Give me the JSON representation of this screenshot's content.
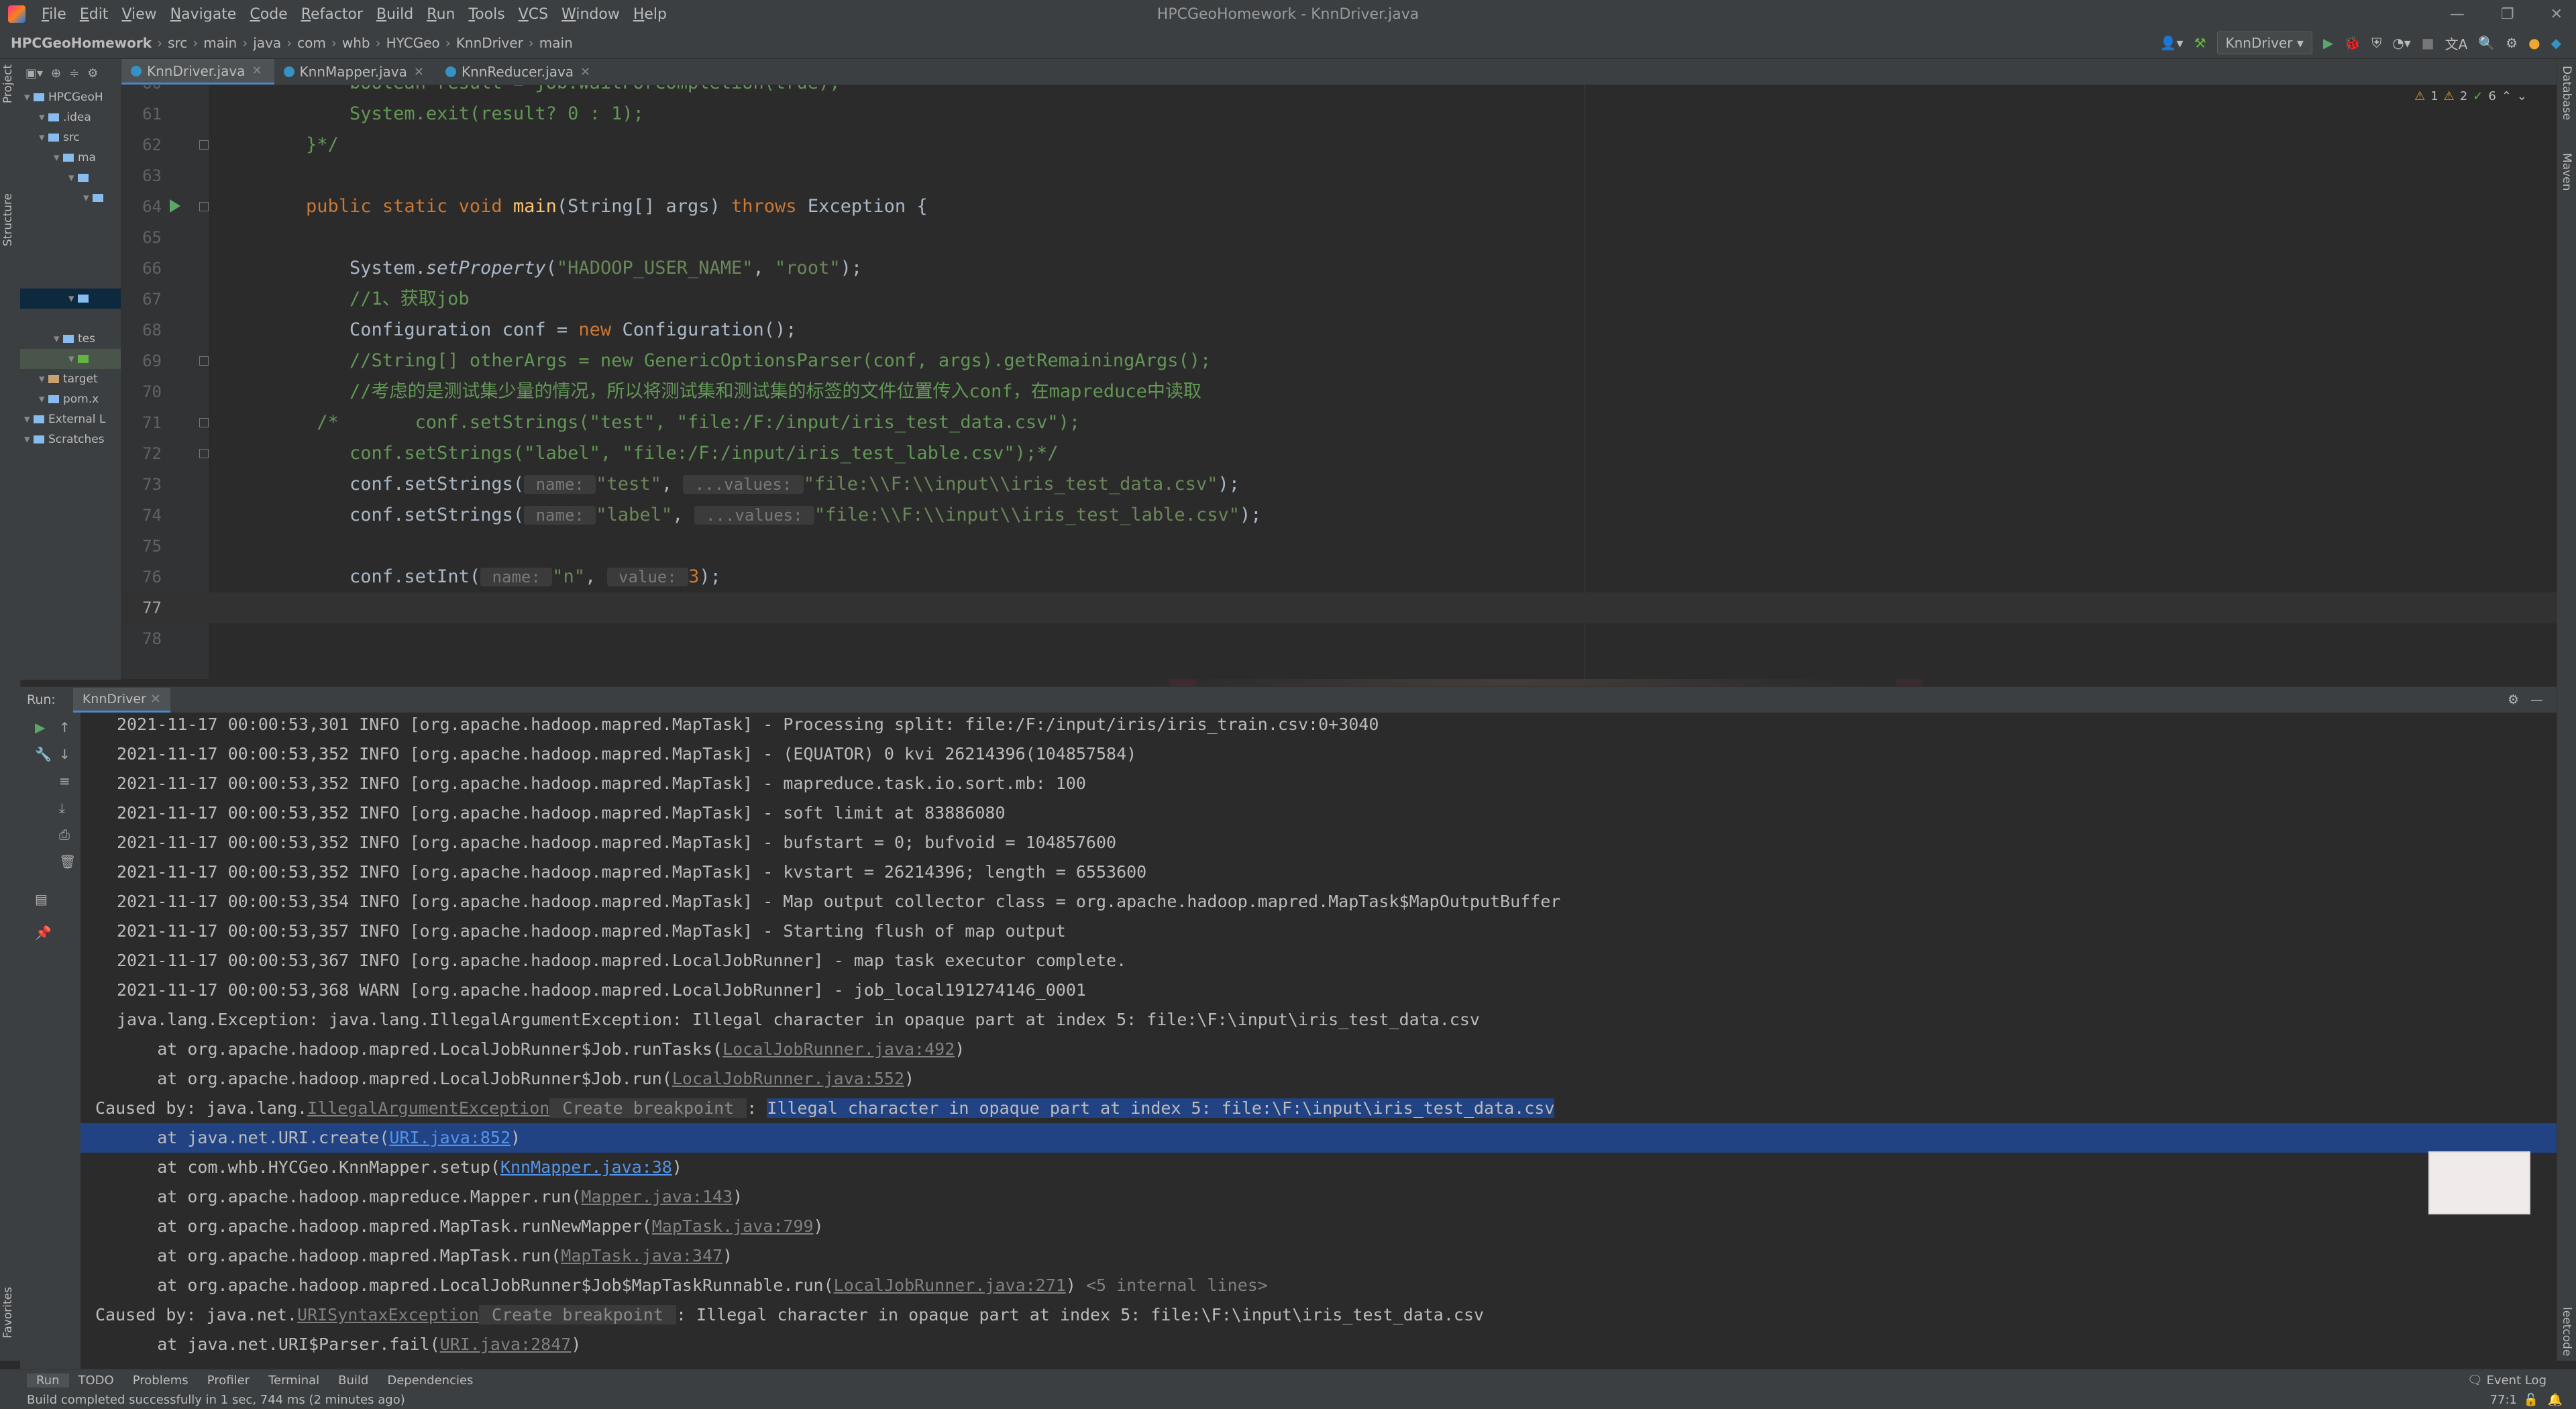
{
  "window": {
    "title": "HPCGeoHomework - KnnDriver.java",
    "menu": [
      {
        "mnemonic": "F",
        "rest": "ile"
      },
      {
        "mnemonic": "E",
        "rest": "dit"
      },
      {
        "mnemonic": "V",
        "rest": "iew"
      },
      {
        "mnemonic": "N",
        "rest": "avigate"
      },
      {
        "mnemonic": "C",
        "rest": "ode"
      },
      {
        "mnemonic": "R",
        "rest": "efactor"
      },
      {
        "mnemonic": "B",
        "rest": "uild"
      },
      {
        "mnemonic": "R",
        "rest": "un"
      },
      {
        "mnemonic": "T",
        "rest": "ools"
      },
      {
        "mnemonic": "V",
        "rest": "CS"
      },
      {
        "mnemonic": "W",
        "rest": "indow"
      },
      {
        "mnemonic": "H",
        "rest": "elp"
      }
    ]
  },
  "breadcrumb": [
    "HPCGeoHomework",
    "src",
    "main",
    "java",
    "com",
    "whb",
    "HYCGeo",
    "KnnDriver",
    "main"
  ],
  "run_config": "KnnDriver",
  "left_tabs": [
    "Project",
    "Structure",
    "Favorites"
  ],
  "right_tabs": [
    "Database",
    "Maven",
    "leetcode"
  ],
  "project_tree": [
    {
      "label": "HPCGeoH",
      "indent": 0,
      "state": ""
    },
    {
      "label": ".idea",
      "indent": 1,
      "state": ""
    },
    {
      "label": "src",
      "indent": 1,
      "state": ""
    },
    {
      "label": "ma",
      "indent": 2,
      "state": ""
    },
    {
      "label": "",
      "indent": 3,
      "state": ""
    },
    {
      "label": "",
      "indent": 4,
      "state": ""
    },
    {
      "label": "",
      "indent": 0,
      "state": "blank"
    },
    {
      "label": "",
      "indent": 0,
      "state": "blank"
    },
    {
      "label": "",
      "indent": 0,
      "state": "blank"
    },
    {
      "label": "",
      "indent": 0,
      "state": "blank"
    },
    {
      "label": "",
      "indent": 3,
      "state": "sel"
    },
    {
      "label": "",
      "indent": 0,
      "state": "blank"
    },
    {
      "label": "tes",
      "indent": 2,
      "state": ""
    },
    {
      "label": "",
      "indent": 3,
      "state": "hl"
    },
    {
      "label": "target",
      "indent": 1,
      "state": ""
    },
    {
      "label": "pom.x",
      "indent": 1,
      "state": ""
    },
    {
      "label": "External L",
      "indent": 0,
      "state": ""
    },
    {
      "label": "Scratches",
      "indent": 0,
      "state": ""
    }
  ],
  "tabs": [
    {
      "label": "KnnDriver.java",
      "active": true
    },
    {
      "label": "KnnMapper.java",
      "active": false
    },
    {
      "label": "KnnReducer.java",
      "active": false
    }
  ],
  "inspections": {
    "warnings": "1",
    "weak": "2",
    "typos": "6"
  },
  "editor": {
    "current_line": "77",
    "lines": [
      {
        "n": "60",
        "segs": [
          {
            "t": "        boolean result = job.waitForCompletion(",
            "c": "cm-cn"
          },
          {
            "t": "true",
            "c": "cm-cn"
          },
          {
            "t": ");",
            "c": "cm-cn"
          }
        ]
      },
      {
        "n": "61",
        "segs": [
          {
            "t": "        System.exit(result? 0 : 1);",
            "c": "cm-cn"
          }
        ]
      },
      {
        "n": "62",
        "segs": [
          {
            "t": "    }*/",
            "c": "cm-cn"
          }
        ]
      },
      {
        "n": "63",
        "segs": []
      },
      {
        "n": "64",
        "segs": [
          {
            "t": "    ",
            "c": ""
          },
          {
            "t": "public static void ",
            "c": "kw"
          },
          {
            "t": "main",
            "c": "fn"
          },
          {
            "t": "(String[] args) ",
            "c": ""
          },
          {
            "t": "throws ",
            "c": "kw"
          },
          {
            "t": "Exception {",
            "c": ""
          }
        ]
      },
      {
        "n": "65",
        "segs": []
      },
      {
        "n": "66",
        "segs": [
          {
            "t": "        System.",
            "c": ""
          },
          {
            "t": "setProperty",
            "c": "it"
          },
          {
            "t": "(",
            "c": ""
          },
          {
            "t": "\"HADOOP_USER_NAME\"",
            "c": "str"
          },
          {
            "t": ", ",
            "c": ""
          },
          {
            "t": "\"root\"",
            "c": "str"
          },
          {
            "t": ");",
            "c": ""
          }
        ]
      },
      {
        "n": "67",
        "segs": [
          {
            "t": "        //1、获取job",
            "c": "cm-cn"
          }
        ]
      },
      {
        "n": "68",
        "segs": [
          {
            "t": "        Configuration conf = ",
            "c": ""
          },
          {
            "t": "new ",
            "c": "kw"
          },
          {
            "t": "Configuration();",
            "c": ""
          }
        ]
      },
      {
        "n": "69",
        "segs": [
          {
            "t": "        //String[] otherArgs = new GenericOptionsParser(conf, args).getRemainingArgs();",
            "c": "cm-cn"
          }
        ]
      },
      {
        "n": "70",
        "segs": [
          {
            "t": "        //考虑的是测试集少量的情况，所以将测试集和测试集的标签的文件位置传入conf，在mapreduce中读取",
            "c": "cm-cn"
          }
        ]
      },
      {
        "n": "71",
        "segs": [
          {
            "t": "     /*",
            "c": "cm-cn"
          },
          {
            "t": "       conf.setStrings(\"test\", \"file:/F:/input/iris_test_data.csv\");",
            "c": "cm-cn"
          }
        ]
      },
      {
        "n": "72",
        "segs": [
          {
            "t": "        conf.setStrings(\"label\", \"file:/F:/input/iris_test_lable.csv\");*/",
            "c": "cm-cn"
          }
        ]
      },
      {
        "n": "73",
        "segs": [
          {
            "t": "        conf.setStrings(",
            "c": ""
          },
          {
            "t": " name: ",
            "c": "hint"
          },
          {
            "t": "\"test\"",
            "c": "str"
          },
          {
            "t": ", ",
            "c": ""
          },
          {
            "t": " ...values: ",
            "c": "hint"
          },
          {
            "t": "\"file:\\\\F:\\\\input\\\\iris_test_data.csv\"",
            "c": "str"
          },
          {
            "t": ");",
            "c": ""
          }
        ]
      },
      {
        "n": "74",
        "segs": [
          {
            "t": "        conf.setStrings(",
            "c": ""
          },
          {
            "t": " name: ",
            "c": "hint"
          },
          {
            "t": "\"label\"",
            "c": "str"
          },
          {
            "t": ", ",
            "c": ""
          },
          {
            "t": " ...values: ",
            "c": "hint"
          },
          {
            "t": "\"file:\\\\F:\\\\input\\\\iris_test_lable.csv\"",
            "c": "str"
          },
          {
            "t": ");",
            "c": ""
          }
        ]
      },
      {
        "n": "75",
        "segs": []
      },
      {
        "n": "76",
        "segs": [
          {
            "t": "        conf.setInt(",
            "c": ""
          },
          {
            "t": " name: ",
            "c": "hint"
          },
          {
            "t": "\"n\"",
            "c": "str"
          },
          {
            "t": ", ",
            "c": ""
          },
          {
            "t": " value: ",
            "c": "hint"
          },
          {
            "t": "3",
            "c": "kw"
          },
          {
            "t": ");",
            "c": ""
          }
        ]
      },
      {
        "n": "77",
        "segs": []
      },
      {
        "n": "78",
        "segs": []
      }
    ]
  },
  "run": {
    "label": "Run:",
    "tab": "KnnDriver",
    "console": [
      {
        "segs": [
          {
            "t": "2021-11-17 00:00:53,301 INFO [org.apache.hadoop.mapred.MapTask] - Processing split: file:/F:/input/iris/iris_train.csv:0+3040"
          }
        ]
      },
      {
        "segs": [
          {
            "t": "2021-11-17 00:00:53,352 INFO [org.apache.hadoop.mapred.MapTask] - (EQUATOR) 0 kvi 26214396(104857584)"
          }
        ]
      },
      {
        "segs": [
          {
            "t": "2021-11-17 00:00:53,352 INFO [org.apache.hadoop.mapred.MapTask] - mapreduce.task.io.sort.mb: 100"
          }
        ]
      },
      {
        "segs": [
          {
            "t": "2021-11-17 00:00:53,352 INFO [org.apache.hadoop.mapred.MapTask] - soft limit at 83886080"
          }
        ]
      },
      {
        "segs": [
          {
            "t": "2021-11-17 00:00:53,352 INFO [org.apache.hadoop.mapred.MapTask] - bufstart = 0; bufvoid = 104857600"
          }
        ]
      },
      {
        "segs": [
          {
            "t": "2021-11-17 00:00:53,352 INFO [org.apache.hadoop.mapred.MapTask] - kvstart = 26214396; length = 6553600"
          }
        ]
      },
      {
        "segs": [
          {
            "t": "2021-11-17 00:00:53,354 INFO [org.apache.hadoop.mapred.MapTask] - Map output collector class = org.apache.hadoop.mapred.MapTask$MapOutputBuffer"
          }
        ]
      },
      {
        "segs": [
          {
            "t": "2021-11-17 00:00:53,357 INFO [org.apache.hadoop.mapred.MapTask] - Starting flush of map output"
          }
        ]
      },
      {
        "segs": [
          {
            "t": "2021-11-17 00:00:53,367 INFO [org.apache.hadoop.mapred.LocalJobRunner] - map task executor complete."
          }
        ]
      },
      {
        "segs": [
          {
            "t": "2021-11-17 00:00:53,368 WARN [org.apache.hadoop.mapred.LocalJobRunner] - job_local191274146_0001"
          }
        ]
      },
      {
        "segs": [
          {
            "t": "java.lang.Exception: java.lang.IllegalArgumentException: Illegal character in opaque part at index 5: file:\\F:\\input\\iris_test_data.csv"
          }
        ]
      },
      {
        "segs": [
          {
            "t": "    at org.apache.hadoop.mapred.LocalJobRunner$Job.runTasks("
          },
          {
            "t": "LocalJobRunner.java:492",
            "c": "lnk"
          },
          {
            "t": ")"
          }
        ]
      },
      {
        "segs": [
          {
            "t": "    at org.apache.hadoop.mapred.LocalJobRunner$Job.run("
          },
          {
            "t": "LocalJobRunner.java:552",
            "c": "lnk"
          },
          {
            "t": ")"
          }
        ]
      },
      {
        "segs": [
          {
            "t": "Caused by: java.lang."
          },
          {
            "t": "IllegalArgumentException",
            "c": "lnk"
          },
          {
            "t": " Create breakpoint ",
            "c": "bp-hint"
          },
          {
            "t": ": "
          },
          {
            "t": "Illegal character in opaque part at index 5: file:\\F:\\input\\iris_test_data.csv",
            "c": "sel-inline"
          }
        ]
      },
      {
        "segs": [
          {
            "t": "    at java.net.URI.create("
          },
          {
            "t": "URI.java:852",
            "c": "lnk-blue"
          },
          {
            "t": ")"
          }
        ],
        "sel": true
      },
      {
        "segs": [
          {
            "t": "    at com.whb.HYCGeo.KnnMapper.setup("
          },
          {
            "t": "KnnMapper.java:38",
            "c": "lnk-blue"
          },
          {
            "t": ")"
          }
        ]
      },
      {
        "segs": [
          {
            "t": "    at org.apache.hadoop.mapreduce.Mapper.run("
          },
          {
            "t": "Mapper.java:143",
            "c": "lnk"
          },
          {
            "t": ")"
          }
        ]
      },
      {
        "segs": [
          {
            "t": "    at org.apache.hadoop.mapred.MapTask.runNewMapper("
          },
          {
            "t": "MapTask.java:799",
            "c": "lnk"
          },
          {
            "t": ")"
          }
        ]
      },
      {
        "segs": [
          {
            "t": "    at org.apache.hadoop.mapred.MapTask.run("
          },
          {
            "t": "MapTask.java:347",
            "c": "lnk"
          },
          {
            "t": ")"
          }
        ]
      },
      {
        "segs": [
          {
            "t": "    at org.apache.hadoop.mapred.LocalJobRunner$Job$MapTaskRunnable.run("
          },
          {
            "t": "LocalJobRunner.java:271",
            "c": "lnk"
          },
          {
            "t": ") "
          },
          {
            "t": "<5 internal lines>",
            "c": "cm"
          }
        ]
      },
      {
        "segs": [
          {
            "t": "Caused by: java.net."
          },
          {
            "t": "URISyntaxException",
            "c": "lnk"
          },
          {
            "t": " Create breakpoint ",
            "c": "bp-hint"
          },
          {
            "t": ": Illegal character in opaque part at index 5: file:\\F:\\input\\iris_test_data.csv"
          }
        ]
      },
      {
        "segs": [
          {
            "t": "    at java.net.URI$Parser.fail("
          },
          {
            "t": "URI.java:2847",
            "c": "lnk"
          },
          {
            "t": ")"
          }
        ]
      }
    ]
  },
  "bottom_tabs": [
    {
      "label": "Run",
      "active": true
    },
    {
      "label": "TODO",
      "active": false
    },
    {
      "label": "Problems",
      "active": false
    },
    {
      "label": "Profiler",
      "active": false
    },
    {
      "label": "Terminal",
      "active": false
    },
    {
      "label": "Build",
      "active": false
    },
    {
      "label": "Dependencies",
      "active": false
    }
  ],
  "event_log": "Event Log",
  "status": {
    "message": "Build completed successfully in 1 sec, 744 ms (2 minutes ago)",
    "position": "77:1"
  }
}
